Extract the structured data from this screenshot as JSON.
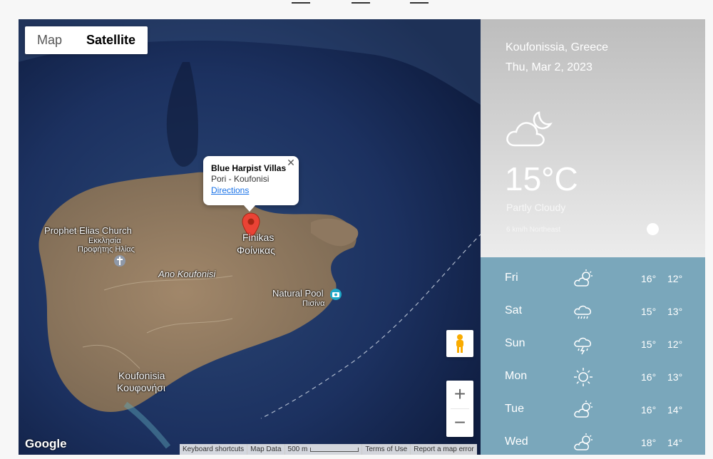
{
  "map": {
    "type_control": {
      "map_label": "Map",
      "satellite_label": "Satellite"
    },
    "info_window": {
      "title": "Blue Harpist Villas",
      "address": "Pori - Koufonisi",
      "directions_label": "Directions",
      "close_label": "✕"
    },
    "labels": {
      "prophet_en": "Prophet Elias Church",
      "prophet_gr1": "Εκκλησία",
      "prophet_gr2": "Προφήτης Ηλίας",
      "finikas_en": "Finikas",
      "finikas_gr": "Φοίνικας",
      "ano_koufonisi": "Ano Koufonisi",
      "natural_pool_en": "Natural Pool",
      "natural_pool_gr": "Πισίνα",
      "koufonisia_en": "Koufonisia",
      "koufonisia_gr": "Κουφονήσι"
    },
    "zoom": {
      "in_label": "+",
      "out_label": "−"
    },
    "logo": "Google",
    "attribution": {
      "shortcuts": "Keyboard shortcuts",
      "map_data": "Map Data",
      "scale": "500 m",
      "terms": "Terms of Use",
      "report": "Report a map error"
    }
  },
  "weather": {
    "location": "Koufonissia, Greece",
    "date": "Thu, Mar 2, 2023",
    "temperature": "15°C",
    "condition": "Partly Cloudy",
    "wind": "6 km/h Northeast",
    "forecast": [
      {
        "day": "Fri",
        "icon": "partly-cloudy-icon",
        "high": "16°",
        "low": "12°"
      },
      {
        "day": "Sat",
        "icon": "rain-icon",
        "high": "15°",
        "low": "13°"
      },
      {
        "day": "Sun",
        "icon": "thunderstorm-icon",
        "high": "15°",
        "low": "12°"
      },
      {
        "day": "Mon",
        "icon": "sun-icon",
        "high": "16°",
        "low": "13°"
      },
      {
        "day": "Tue",
        "icon": "partly-sunny-icon",
        "high": "16°",
        "low": "14°"
      },
      {
        "day": "Wed",
        "icon": "partly-sunny-icon",
        "high": "18°",
        "low": "14°"
      }
    ]
  }
}
